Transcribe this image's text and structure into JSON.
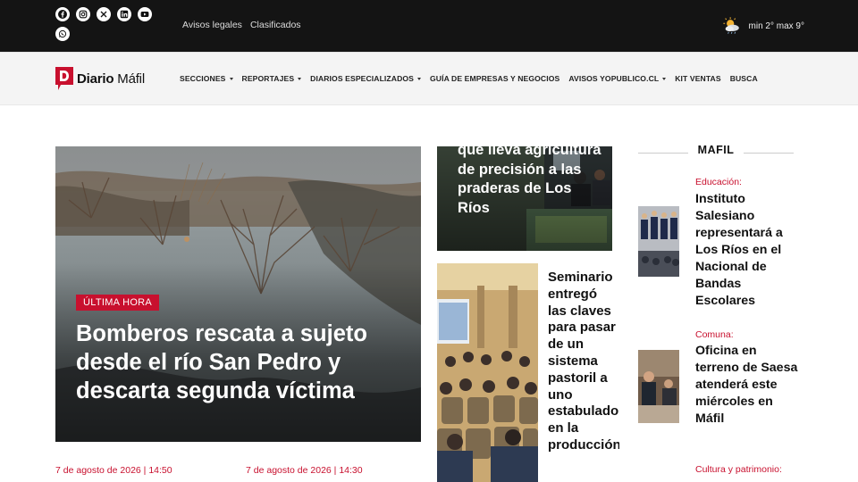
{
  "topbar": {
    "social_icons": [
      "facebook-icon",
      "instagram-icon",
      "x-icon",
      "linkedin-icon",
      "youtube-icon",
      "whatsapp-icon"
    ],
    "links": [
      "Avisos legales",
      "Clasificados"
    ],
    "weather": {
      "icon": "cloud-sun-icon",
      "text": "min 2° max 9°"
    }
  },
  "nav": {
    "logo": {
      "bold": "Diario",
      "light": "Máfil"
    },
    "items": [
      {
        "label": "SECCIONES",
        "dropdown": true
      },
      {
        "label": "REPORTAJES",
        "dropdown": true
      },
      {
        "label": "DIARIOS ESPECIALIZADOS",
        "dropdown": true
      },
      {
        "label": "GUÍA DE EMPRESAS Y NEGOCIOS",
        "dropdown": false
      },
      {
        "label": "AVISOS YOPUBLICO.CL",
        "dropdown": true
      },
      {
        "label": "KIT VENTAS",
        "dropdown": false
      },
      {
        "label": "BUSCA",
        "dropdown": false
      }
    ]
  },
  "hero": {
    "badge": "ÚLTIMA HORA",
    "title": "Bomberos rescata a sujeto desde el río San Pedro y descarta segunda víctima"
  },
  "dates": [
    "7 de agosto de 2026 | 14:50",
    "7 de agosto de 2026 | 14:30"
  ],
  "middle": {
    "card1_title": "que lleva agricultura de precisión a las praderas de Los Ríos",
    "card2_title": "Seminario entregó las claves para pasar de un sistema pastoril a uno estabulado en la producción"
  },
  "sidebar": {
    "section_title": "MAFIL",
    "items": [
      {
        "category": "Educación:",
        "title": "Instituto Salesiano representará a Los Ríos en el Nacional de Bandas Escolares"
      },
      {
        "category": "Comuna:",
        "title": "Oficina en terreno de Saesa atenderá este miércoles en Máfil"
      },
      {
        "category": "Cultura y patrimonio:",
        "title": ""
      }
    ]
  },
  "colors": {
    "accent": "#c8102e",
    "topbar": "#141414",
    "navbar": "#f4f4f4"
  }
}
